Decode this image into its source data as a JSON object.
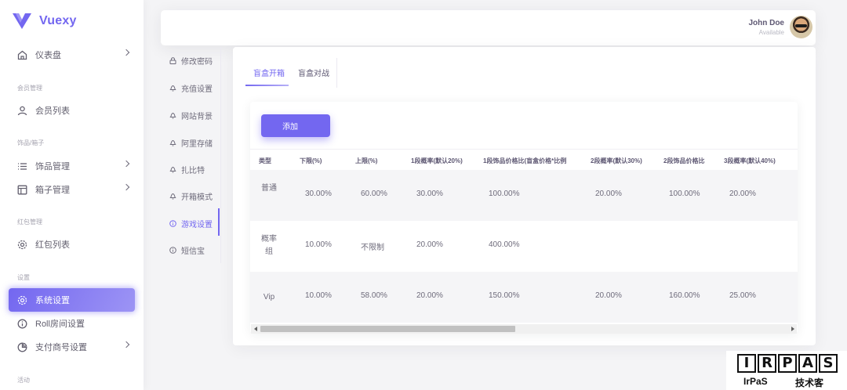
{
  "brand": {
    "name": "Vuexy",
    "accent": "#7367f0"
  },
  "sidebar": {
    "dashboard": "仪表盘",
    "sections": {
      "members": "会员管理",
      "items": "饰品/箱子",
      "redpacket": "红包管理",
      "settings": "设置",
      "activity": "活动"
    },
    "items": [
      {
        "label": "会员列表",
        "icon": "user-icon"
      },
      {
        "label": "饰品管理",
        "icon": "list-icon"
      },
      {
        "label": "箱子管理",
        "icon": "layout-icon"
      },
      {
        "label": "红包列表",
        "icon": "gear-icon"
      },
      {
        "label": "系统设置",
        "icon": "gear-icon"
      },
      {
        "label": "Roll房间设置",
        "icon": "info-icon"
      },
      {
        "label": "支付商号设置",
        "icon": "pie-chart-icon"
      }
    ]
  },
  "header": {
    "user_name": "John Doe",
    "user_status": "Available"
  },
  "settings_menu": [
    {
      "label": "修改密码",
      "icon": "lock-icon"
    },
    {
      "label": "充值设置",
      "icon": "bell-icon"
    },
    {
      "label": "网站背景",
      "icon": "bell-icon"
    },
    {
      "label": "阿里存储",
      "icon": "bell-icon"
    },
    {
      "label": "扎比特",
      "icon": "bell-icon"
    },
    {
      "label": "开箱模式",
      "icon": "bell-icon"
    },
    {
      "label": "游戏设置",
      "icon": "info-icon"
    },
    {
      "label": "短信宝",
      "icon": "info-icon"
    }
  ],
  "tabs": [
    "盲盒开箱",
    "盲盒对战"
  ],
  "add_button": "添加",
  "table": {
    "headers": [
      "类型",
      "下限(%)",
      "上限(%)",
      "1段概率(默认20%)",
      "1段饰品价格比(盲盒价格*比例",
      "2段概率(默认30%)",
      "2段饰品价格比",
      "3段概率(默认40%)"
    ],
    "rows": [
      [
        "普通",
        "30.00%",
        "60.00%",
        "30.00%",
        "100.00%",
        "20.00%",
        "100.00%",
        "20.00%"
      ],
      [
        "概率组",
        "10.00%",
        "不限制",
        "20.00%",
        "400.00%",
        "",
        "",
        ""
      ],
      [
        "Vip",
        "10.00%",
        "58.00%",
        "20.00%",
        "150.00%",
        "20.00%",
        "160.00%",
        "25.00%"
      ]
    ]
  },
  "watermark": {
    "letters": [
      "I",
      "R",
      "P",
      "A",
      "S"
    ],
    "left": "IrPaS",
    "right": "技术客"
  }
}
